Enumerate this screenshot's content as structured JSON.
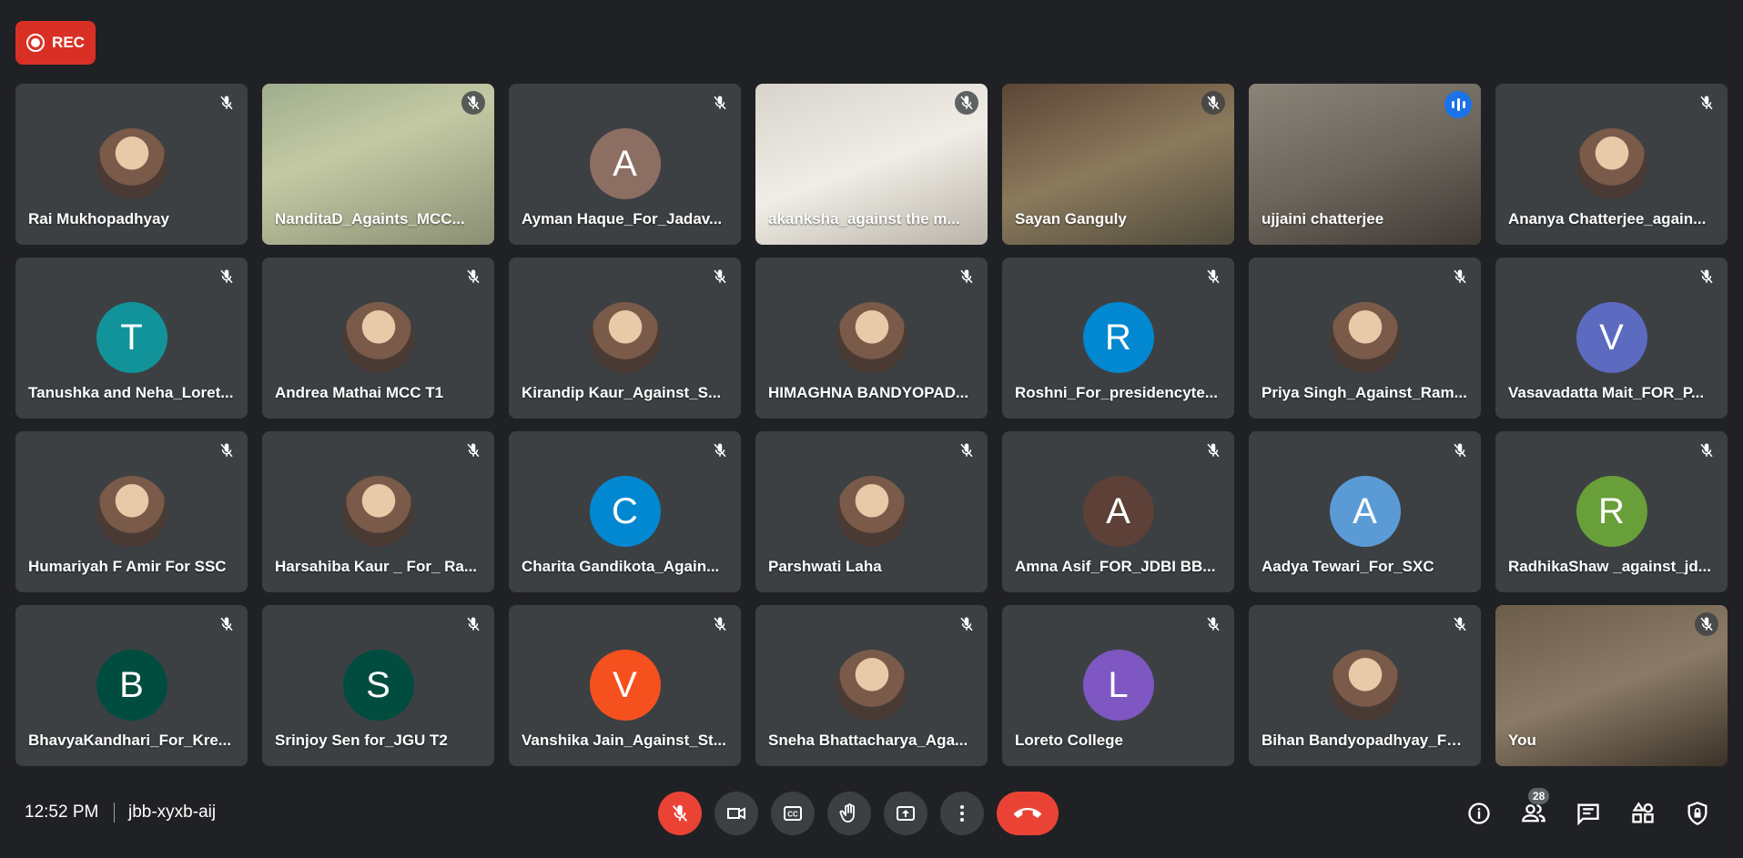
{
  "recording": {
    "label": "REC"
  },
  "meeting": {
    "time": "12:52 PM",
    "code": "jbb-xyxb-aij",
    "participant_count": "28"
  },
  "colors": {
    "background": "#202124",
    "tile": "#3c4043",
    "accent": "#8ab4f8",
    "danger": "#ea4335"
  },
  "participants": [
    {
      "name": "Rai Mukhopadhyay",
      "type": "photo"
    },
    {
      "name": "NanditaD_Againts_MCC...",
      "type": "video"
    },
    {
      "name": "Ayman Haque_For_Jadav...",
      "type": "letter",
      "letter": "A",
      "color": "#8d6e63"
    },
    {
      "name": "akanksha_against the m...",
      "type": "video"
    },
    {
      "name": "Sayan Ganguly",
      "type": "video"
    },
    {
      "name": "ujjaini chatterjee",
      "type": "video",
      "speaking": true
    },
    {
      "name": "Ananya Chatterjee_again...",
      "type": "photo"
    },
    {
      "name": "Tanushka and Neha_Loret...",
      "type": "letter",
      "letter": "T",
      "color": "#12939a"
    },
    {
      "name": "Andrea Mathai MCC T1",
      "type": "photo"
    },
    {
      "name": "Kirandip Kaur_Against_S...",
      "type": "photo"
    },
    {
      "name": "HIMAGHNA BANDYOPAD...",
      "type": "photo"
    },
    {
      "name": "Roshni_For_presidencyte...",
      "type": "letter",
      "letter": "R",
      "color": "#0288d1"
    },
    {
      "name": "Priya Singh_Against_Ram...",
      "type": "photo"
    },
    {
      "name": "Vasavadatta Mait_FOR_P...",
      "type": "letter",
      "letter": "V",
      "color": "#5c6bc0"
    },
    {
      "name": "Humariyah F Amir For SSC",
      "type": "photo"
    },
    {
      "name": "Harsahiba Kaur _ For_ Ra...",
      "type": "photo"
    },
    {
      "name": "Charita Gandikota_Again...",
      "type": "letter",
      "letter": "C",
      "color": "#0288d1"
    },
    {
      "name": "Parshwati Laha",
      "type": "photo"
    },
    {
      "name": "Amna Asif_FOR_JDBI BB...",
      "type": "letter",
      "letter": "A",
      "color": "#5d4037"
    },
    {
      "name": "Aadya Tewari_For_SXC",
      "type": "letter",
      "letter": "A",
      "color": "#5b9bd5"
    },
    {
      "name": "RadhikaShaw _against_jd...",
      "type": "letter",
      "letter": "R",
      "color": "#689f38"
    },
    {
      "name": "BhavyaKandhari_For_Kre...",
      "type": "letter",
      "letter": "B",
      "color": "#004d40"
    },
    {
      "name": "Srinjoy Sen for_JGU T2",
      "type": "letter",
      "letter": "S",
      "color": "#004d40"
    },
    {
      "name": "Vanshika Jain_Against_St...",
      "type": "letter",
      "letter": "V",
      "color": "#f4511e"
    },
    {
      "name": "Sneha Bhattacharya_Aga...",
      "type": "photo"
    },
    {
      "name": "Loreto College",
      "type": "letter",
      "letter": "L",
      "color": "#7e57c2"
    },
    {
      "name": "Bihan Bandyopadhyay_Fo...",
      "type": "photo"
    },
    {
      "name": "You",
      "type": "video"
    }
  ],
  "controls": [
    {
      "name": "microphone-toggle-button",
      "icon": "mic-off-icon"
    },
    {
      "name": "camera-toggle-button",
      "icon": "camera-icon"
    },
    {
      "name": "captions-button",
      "icon": "cc-icon"
    },
    {
      "name": "raise-hand-button",
      "icon": "hand-icon"
    },
    {
      "name": "present-screen-button",
      "icon": "present-icon"
    },
    {
      "name": "more-options-button",
      "icon": "more-vert-icon"
    },
    {
      "name": "leave-call-button",
      "icon": "hangup-icon"
    }
  ],
  "side_controls": [
    {
      "name": "meeting-details-button",
      "icon": "info-icon"
    },
    {
      "name": "people-button",
      "icon": "people-icon"
    },
    {
      "name": "chat-button",
      "icon": "chat-icon"
    },
    {
      "name": "activities-button",
      "icon": "shapes-icon"
    },
    {
      "name": "host-controls-button",
      "icon": "shield-lock-icon"
    }
  ]
}
